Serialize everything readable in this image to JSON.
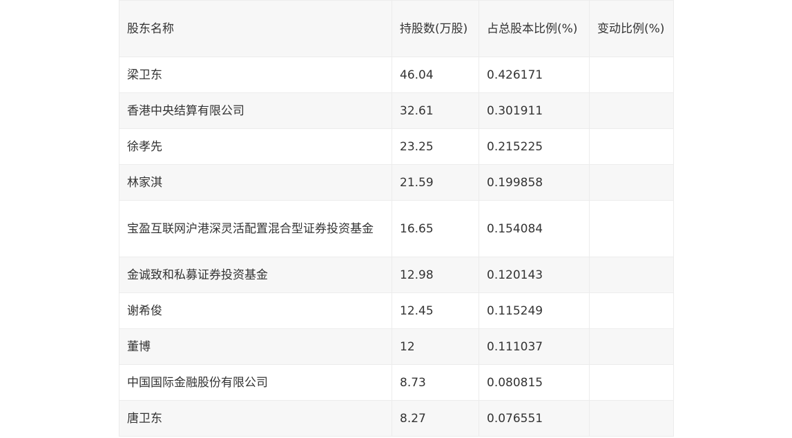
{
  "table": {
    "headers": [
      "股东名称",
      "持股数(万股)",
      "占总股本比例(%)",
      "变动比例(%)"
    ],
    "rows": [
      {
        "name": "梁卫东",
        "shares": "46.04",
        "ratio": "0.426171",
        "change": ""
      },
      {
        "name": "香港中央结算有限公司",
        "shares": "32.61",
        "ratio": "0.301911",
        "change": ""
      },
      {
        "name": "徐孝先",
        "shares": "23.25",
        "ratio": "0.215225",
        "change": ""
      },
      {
        "name": "林家淇",
        "shares": "21.59",
        "ratio": "0.199858",
        "change": ""
      },
      {
        "name": "宝盈互联网沪港深灵活配置混合型证券投资基金",
        "shares": "16.65",
        "ratio": "0.154084",
        "change": ""
      },
      {
        "name": "金诚致和私募证券投资基金",
        "shares": "12.98",
        "ratio": "0.120143",
        "change": ""
      },
      {
        "name": "谢希俊",
        "shares": "12.45",
        "ratio": "0.115249",
        "change": ""
      },
      {
        "name": "董博",
        "shares": "12",
        "ratio": "0.111037",
        "change": ""
      },
      {
        "name": "中国国际金融股份有限公司",
        "shares": "8.73",
        "ratio": "0.080815",
        "change": ""
      },
      {
        "name": "唐卫东",
        "shares": "8.27",
        "ratio": "0.076551",
        "change": ""
      }
    ]
  }
}
